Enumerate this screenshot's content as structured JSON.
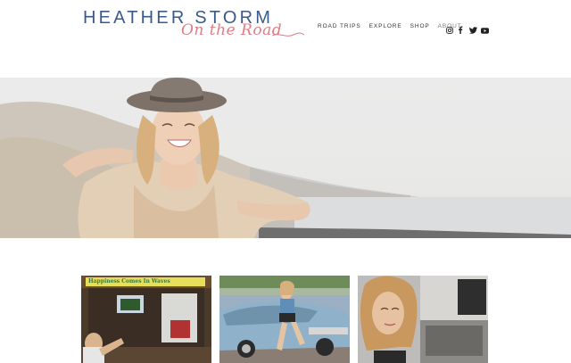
{
  "site": {
    "logo_main": "HEATHER STORM",
    "logo_sub": "On the Road"
  },
  "nav": {
    "items": [
      {
        "label": "ROAD TRIPS"
      },
      {
        "label": "EXPLORE"
      },
      {
        "label": "SHOP"
      },
      {
        "label": "ABOUT"
      }
    ]
  },
  "social": {
    "icons": [
      "instagram-icon",
      "facebook-icon",
      "twitter-icon",
      "youtube-icon"
    ]
  },
  "thumbnails": {
    "first_sign_text": "Happiness Comes In Waves"
  },
  "colors": {
    "brand_blue": "#3b5a8c",
    "brand_pink": "#e27b86",
    "background": "#ffffff"
  }
}
